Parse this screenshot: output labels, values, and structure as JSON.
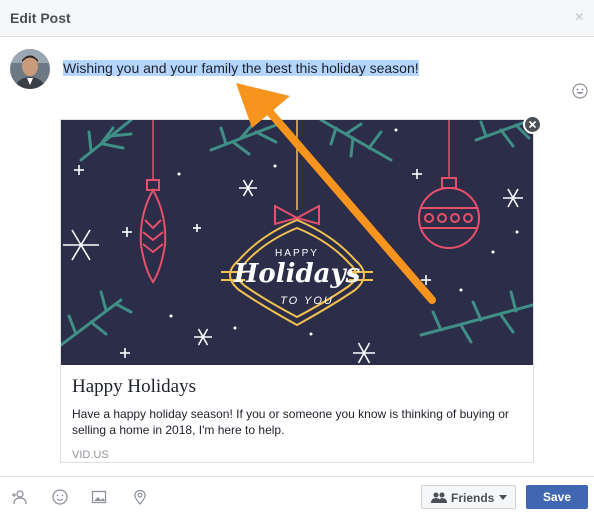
{
  "dialog": {
    "title": "Edit Post",
    "close_icon": "×"
  },
  "post": {
    "text": "Wishing you and your family the best this holiday season!"
  },
  "link_card": {
    "image_text_top": "HAPPY",
    "image_text_main": "Holidays",
    "image_text_bottom": "TO YOU",
    "title": "Happy Holidays",
    "description": "Have a happy holiday season! If you or someone you know is thinking of buying or selling a home in 2018, I'm here to help.",
    "domain": "VID.US"
  },
  "footer": {
    "audience_label": "Friends",
    "save_label": "Save",
    "icons": [
      "tag-people-icon",
      "feeling-icon",
      "photo-icon",
      "location-icon"
    ]
  },
  "colors": {
    "accent": "#4267b2",
    "highlight": "#b4d5fe",
    "annotation_arrow": "#f7941d",
    "card_bg": "#2b2d49"
  }
}
